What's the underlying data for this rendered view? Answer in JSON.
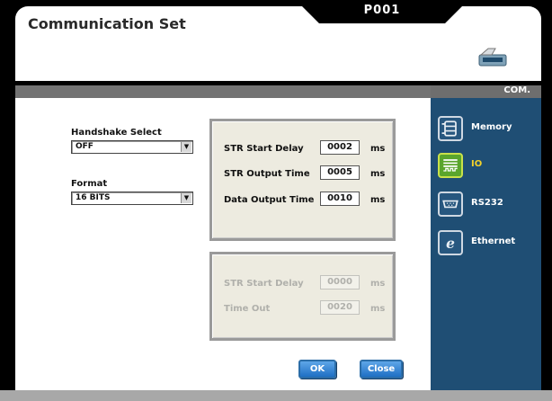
{
  "window": {
    "title": "Communication Set",
    "page_id": "P001",
    "side_header": "COM."
  },
  "handshake": {
    "label": "Handshake Select",
    "value": "OFF"
  },
  "format": {
    "label": "Format",
    "value": "16 BITS"
  },
  "timing_panel": {
    "rows": [
      {
        "label": "STR Start Delay",
        "value": "0002",
        "unit": "ms"
      },
      {
        "label": "STR Output Time",
        "value": "0005",
        "unit": "ms"
      },
      {
        "label": "Data Output Time",
        "value": "0010",
        "unit": "ms"
      }
    ]
  },
  "disabled_panel": {
    "rows": [
      {
        "label": "STR Start Delay",
        "value": "0000",
        "unit": "ms"
      },
      {
        "label": "Time Out",
        "value": "0020",
        "unit": "ms"
      }
    ]
  },
  "buttons": {
    "ok": "OK",
    "close": "Close"
  },
  "nav": [
    {
      "label": "Memory",
      "icon": "memory-icon",
      "active": false
    },
    {
      "label": "IO",
      "icon": "io-icon",
      "active": true
    },
    {
      "label": "RS232",
      "icon": "rs232-icon",
      "active": false
    },
    {
      "label": "Ethernet",
      "icon": "ethernet-icon",
      "active": false
    }
  ],
  "colors": {
    "sidebar": "#1f4e74",
    "active_nav_text": "#f2d22b",
    "button_blue": "#1f6fc4"
  }
}
